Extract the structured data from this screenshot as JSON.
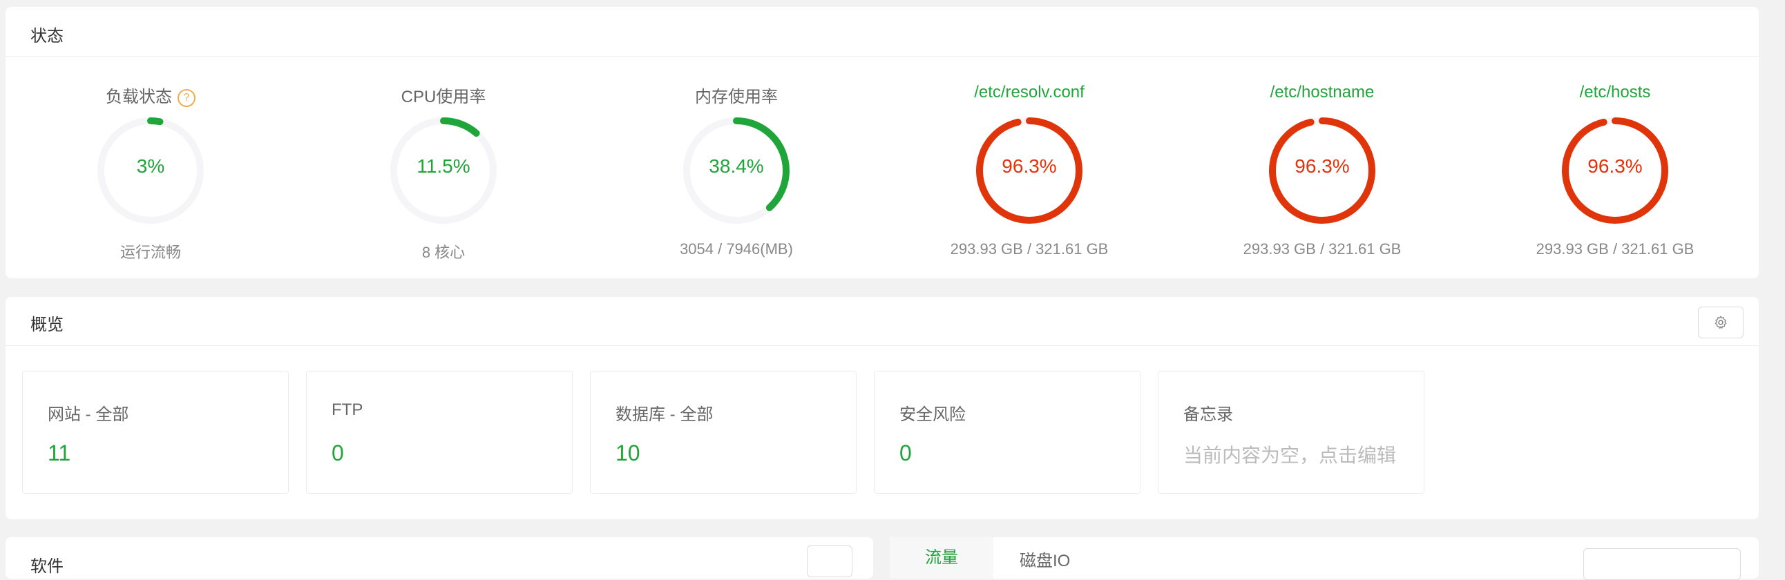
{
  "status": {
    "title": "状态",
    "gauges": [
      {
        "label": "负载状态",
        "value_text": "3%",
        "percent": 3,
        "sub": "运行流畅",
        "color": "#20a53a",
        "label_green": false,
        "help": "?"
      },
      {
        "label": "CPU使用率",
        "value_text": "11.5%",
        "percent": 11.5,
        "sub": "8 核心",
        "color": "#20a53a",
        "label_green": false
      },
      {
        "label": "内存使用率",
        "value_text": "38.4%",
        "percent": 38.4,
        "sub": "3054 / 7946(MB)",
        "color": "#20a53a",
        "label_green": false
      },
      {
        "label": "/etc/resolv.conf",
        "value_text": "96.3%",
        "percent": 96.3,
        "sub": "293.93 GB / 321.61 GB",
        "color": "#e0340a",
        "label_green": true
      },
      {
        "label": "/etc/hostname",
        "value_text": "96.3%",
        "percent": 96.3,
        "sub": "293.93 GB / 321.61 GB",
        "color": "#e0340a",
        "label_green": true
      },
      {
        "label": "/etc/hosts",
        "value_text": "96.3%",
        "percent": 96.3,
        "sub": "293.93 GB / 321.61 GB",
        "color": "#e0340a",
        "label_green": true
      }
    ]
  },
  "overview": {
    "title": "概览",
    "settings_icon": "gear-icon",
    "cards": [
      {
        "title": "网站 - 全部",
        "value": "11"
      },
      {
        "title": "FTP",
        "value": "0"
      },
      {
        "title": "数据库 - 全部",
        "value": "10"
      },
      {
        "title": "安全风险",
        "value": "0"
      },
      {
        "title": "备忘录",
        "placeholder": "当前内容为空，点击编辑"
      }
    ]
  },
  "software": {
    "title": "软件"
  },
  "tabs": {
    "active": "流量",
    "other": "磁盘IO"
  },
  "colors": {
    "accent": "#20a53a",
    "danger": "#e0340a",
    "track": "#f5f5f7"
  }
}
